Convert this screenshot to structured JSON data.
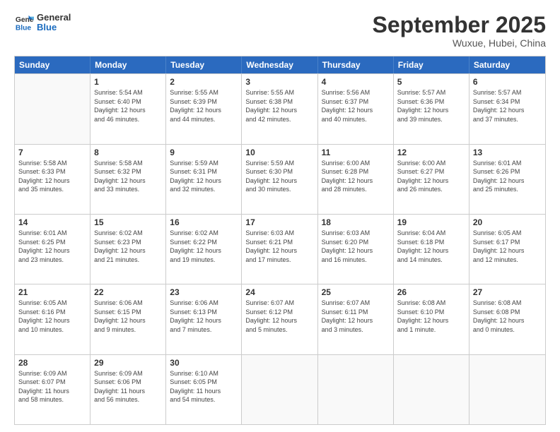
{
  "logo": {
    "line1": "General",
    "line2": "Blue"
  },
  "title": "September 2025",
  "location": "Wuxue, Hubei, China",
  "weekdays": [
    "Sunday",
    "Monday",
    "Tuesday",
    "Wednesday",
    "Thursday",
    "Friday",
    "Saturday"
  ],
  "weeks": [
    [
      {
        "day": "",
        "info": ""
      },
      {
        "day": "1",
        "info": "Sunrise: 5:54 AM\nSunset: 6:40 PM\nDaylight: 12 hours\nand 46 minutes."
      },
      {
        "day": "2",
        "info": "Sunrise: 5:55 AM\nSunset: 6:39 PM\nDaylight: 12 hours\nand 44 minutes."
      },
      {
        "day": "3",
        "info": "Sunrise: 5:55 AM\nSunset: 6:38 PM\nDaylight: 12 hours\nand 42 minutes."
      },
      {
        "day": "4",
        "info": "Sunrise: 5:56 AM\nSunset: 6:37 PM\nDaylight: 12 hours\nand 40 minutes."
      },
      {
        "day": "5",
        "info": "Sunrise: 5:57 AM\nSunset: 6:36 PM\nDaylight: 12 hours\nand 39 minutes."
      },
      {
        "day": "6",
        "info": "Sunrise: 5:57 AM\nSunset: 6:34 PM\nDaylight: 12 hours\nand 37 minutes."
      }
    ],
    [
      {
        "day": "7",
        "info": "Sunrise: 5:58 AM\nSunset: 6:33 PM\nDaylight: 12 hours\nand 35 minutes."
      },
      {
        "day": "8",
        "info": "Sunrise: 5:58 AM\nSunset: 6:32 PM\nDaylight: 12 hours\nand 33 minutes."
      },
      {
        "day": "9",
        "info": "Sunrise: 5:59 AM\nSunset: 6:31 PM\nDaylight: 12 hours\nand 32 minutes."
      },
      {
        "day": "10",
        "info": "Sunrise: 5:59 AM\nSunset: 6:30 PM\nDaylight: 12 hours\nand 30 minutes."
      },
      {
        "day": "11",
        "info": "Sunrise: 6:00 AM\nSunset: 6:28 PM\nDaylight: 12 hours\nand 28 minutes."
      },
      {
        "day": "12",
        "info": "Sunrise: 6:00 AM\nSunset: 6:27 PM\nDaylight: 12 hours\nand 26 minutes."
      },
      {
        "day": "13",
        "info": "Sunrise: 6:01 AM\nSunset: 6:26 PM\nDaylight: 12 hours\nand 25 minutes."
      }
    ],
    [
      {
        "day": "14",
        "info": "Sunrise: 6:01 AM\nSunset: 6:25 PM\nDaylight: 12 hours\nand 23 minutes."
      },
      {
        "day": "15",
        "info": "Sunrise: 6:02 AM\nSunset: 6:23 PM\nDaylight: 12 hours\nand 21 minutes."
      },
      {
        "day": "16",
        "info": "Sunrise: 6:02 AM\nSunset: 6:22 PM\nDaylight: 12 hours\nand 19 minutes."
      },
      {
        "day": "17",
        "info": "Sunrise: 6:03 AM\nSunset: 6:21 PM\nDaylight: 12 hours\nand 17 minutes."
      },
      {
        "day": "18",
        "info": "Sunrise: 6:03 AM\nSunset: 6:20 PM\nDaylight: 12 hours\nand 16 minutes."
      },
      {
        "day": "19",
        "info": "Sunrise: 6:04 AM\nSunset: 6:18 PM\nDaylight: 12 hours\nand 14 minutes."
      },
      {
        "day": "20",
        "info": "Sunrise: 6:05 AM\nSunset: 6:17 PM\nDaylight: 12 hours\nand 12 minutes."
      }
    ],
    [
      {
        "day": "21",
        "info": "Sunrise: 6:05 AM\nSunset: 6:16 PM\nDaylight: 12 hours\nand 10 minutes."
      },
      {
        "day": "22",
        "info": "Sunrise: 6:06 AM\nSunset: 6:15 PM\nDaylight: 12 hours\nand 9 minutes."
      },
      {
        "day": "23",
        "info": "Sunrise: 6:06 AM\nSunset: 6:13 PM\nDaylight: 12 hours\nand 7 minutes."
      },
      {
        "day": "24",
        "info": "Sunrise: 6:07 AM\nSunset: 6:12 PM\nDaylight: 12 hours\nand 5 minutes."
      },
      {
        "day": "25",
        "info": "Sunrise: 6:07 AM\nSunset: 6:11 PM\nDaylight: 12 hours\nand 3 minutes."
      },
      {
        "day": "26",
        "info": "Sunrise: 6:08 AM\nSunset: 6:10 PM\nDaylight: 12 hours\nand 1 minute."
      },
      {
        "day": "27",
        "info": "Sunrise: 6:08 AM\nSunset: 6:08 PM\nDaylight: 12 hours\nand 0 minutes."
      }
    ],
    [
      {
        "day": "28",
        "info": "Sunrise: 6:09 AM\nSunset: 6:07 PM\nDaylight: 11 hours\nand 58 minutes."
      },
      {
        "day": "29",
        "info": "Sunrise: 6:09 AM\nSunset: 6:06 PM\nDaylight: 11 hours\nand 56 minutes."
      },
      {
        "day": "30",
        "info": "Sunrise: 6:10 AM\nSunset: 6:05 PM\nDaylight: 11 hours\nand 54 minutes."
      },
      {
        "day": "",
        "info": ""
      },
      {
        "day": "",
        "info": ""
      },
      {
        "day": "",
        "info": ""
      },
      {
        "day": "",
        "info": ""
      }
    ]
  ]
}
